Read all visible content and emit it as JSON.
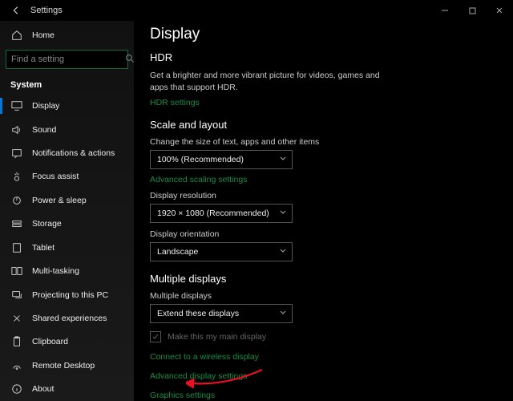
{
  "titlebar": {
    "title": "Settings"
  },
  "search": {
    "placeholder": "Find a setting"
  },
  "sidebar": {
    "home": "Home",
    "group": "System",
    "items": [
      {
        "label": "Display"
      },
      {
        "label": "Sound"
      },
      {
        "label": "Notifications & actions"
      },
      {
        "label": "Focus assist"
      },
      {
        "label": "Power & sleep"
      },
      {
        "label": "Storage"
      },
      {
        "label": "Tablet"
      },
      {
        "label": "Multi-tasking"
      },
      {
        "label": "Projecting to this PC"
      },
      {
        "label": "Shared experiences"
      },
      {
        "label": "Clipboard"
      },
      {
        "label": "Remote Desktop"
      },
      {
        "label": "About"
      }
    ]
  },
  "page": {
    "title": "Display",
    "hdr": {
      "heading": "HDR",
      "desc": "Get a brighter and more vibrant picture for videos, games and apps that support HDR.",
      "link": "HDR settings"
    },
    "scale": {
      "heading": "Scale and layout",
      "size_label": "Change the size of text, apps and other items",
      "size_value": "100% (Recommended)",
      "adv_scaling": "Advanced scaling settings",
      "res_label": "Display resolution",
      "res_value": "1920 × 1080 (Recommended)",
      "orient_label": "Display orientation",
      "orient_value": "Landscape"
    },
    "multi": {
      "heading": "Multiple displays",
      "label": "Multiple displays",
      "value": "Extend these displays",
      "main_display": "Make this my main display",
      "wireless": "Connect to a wireless display",
      "adv": "Advanced display settings",
      "graphics": "Graphics settings"
    }
  }
}
